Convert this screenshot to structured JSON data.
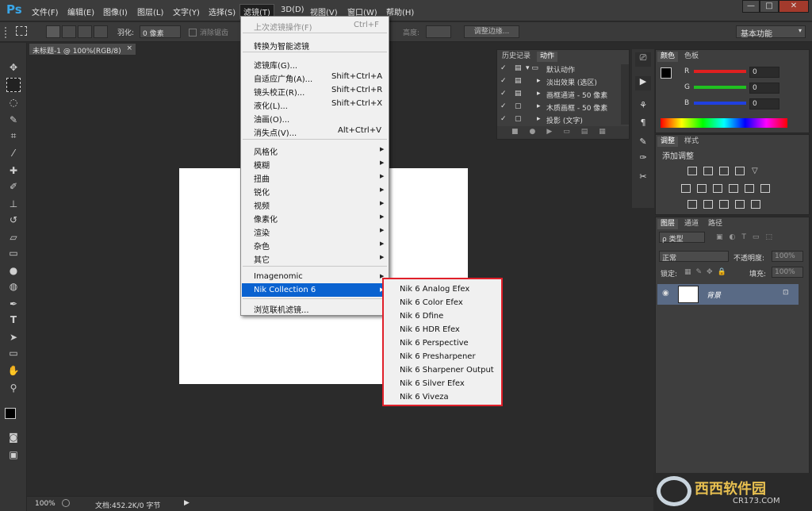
{
  "app": {
    "logo": "Ps"
  },
  "menubar": {
    "items": [
      "文件(F)",
      "编辑(E)",
      "图像(I)",
      "图层(L)",
      "文字(Y)",
      "选择(S)",
      "滤镜(T)",
      "3D(D)",
      "视图(V)",
      "窗口(W)",
      "帮助(H)"
    ],
    "active_index": 6
  },
  "window_controls": {
    "minimize": "—",
    "restore": "□",
    "close": "✕"
  },
  "options": {
    "feather_label": "羽化:",
    "feather_value": "0 像素",
    "antialias_label": "消除锯齿",
    "height_label": "高度:",
    "refine_edge_button": "调整边缘...",
    "workspace": "基本功能"
  },
  "document_tab": {
    "title": "未标题-1 @ 100%(RGB/8)",
    "close": "×"
  },
  "status": {
    "zoom": "100%",
    "doc_info": "文档:452.2K/0 字节"
  },
  "filter_menu": {
    "items": [
      {
        "label": "上次滤镜操作(F)",
        "shortcut": "Ctrl+F",
        "disabled": true
      },
      {
        "label": "转换为智能滤镜"
      },
      {
        "label": "滤镜库(G)..."
      },
      {
        "label": "自适应广角(A)...",
        "shortcut": "Shift+Ctrl+A"
      },
      {
        "label": "镜头校正(R)...",
        "shortcut": "Shift+Ctrl+R"
      },
      {
        "label": "液化(L)...",
        "shortcut": "Shift+Ctrl+X"
      },
      {
        "label": "油画(O)..."
      },
      {
        "label": "消失点(V)...",
        "shortcut": "Alt+Ctrl+V"
      },
      {
        "label": "风格化",
        "submenu": true
      },
      {
        "label": "模糊",
        "submenu": true
      },
      {
        "label": "扭曲",
        "submenu": true
      },
      {
        "label": "锐化",
        "submenu": true
      },
      {
        "label": "视频",
        "submenu": true
      },
      {
        "label": "像素化",
        "submenu": true
      },
      {
        "label": "渲染",
        "submenu": true
      },
      {
        "label": "杂色",
        "submenu": true
      },
      {
        "label": "其它",
        "submenu": true
      },
      {
        "label": "Imagenomic",
        "submenu": true
      },
      {
        "label": "Nik Collection 6",
        "submenu": true,
        "highlighted": true
      },
      {
        "label": "浏览联机滤镜..."
      }
    ]
  },
  "nik_submenu": {
    "items": [
      "Nik 6 Analog Efex",
      "Nik 6 Color Efex",
      "Nik 6 Dfine",
      "Nik 6 HDR Efex",
      "Nik 6 Perspective",
      "Nik 6 Presharpener",
      "Nik 6 Sharpener Output",
      "Nik 6 Silver Efex",
      "Nik 6 Viveza"
    ]
  },
  "history_panel": {
    "tabs": [
      "历史记录",
      "动作"
    ],
    "selected_tab": 1,
    "rows": [
      "默认动作",
      "淡出效果 (选区)",
      "画框通道 - 50 像素",
      "木质画框 - 50 像素",
      "投影 (文字)"
    ]
  },
  "color_panel": {
    "tabs": [
      "颜色",
      "色板"
    ],
    "channels": [
      {
        "label": "R",
        "value": "0",
        "color": "#e02020"
      },
      {
        "label": "G",
        "value": "0",
        "color": "#20c020"
      },
      {
        "label": "B",
        "value": "0",
        "color": "#2040e0"
      }
    ]
  },
  "adjust_panel": {
    "tabs": [
      "调整",
      "样式"
    ],
    "heading": "添加调整"
  },
  "layers_panel": {
    "tabs": [
      "图层",
      "通道",
      "路径"
    ],
    "filter_label": "ρ 类型",
    "blend_mode": "正常",
    "opacity_label": "不透明度:",
    "opacity_value": "100%",
    "lock_label": "锁定:",
    "fill_label": "填充:",
    "fill_value": "100%",
    "layer_name": "背景"
  },
  "watermark": {
    "text": "西西软件园",
    "site": "CR173.COM"
  }
}
